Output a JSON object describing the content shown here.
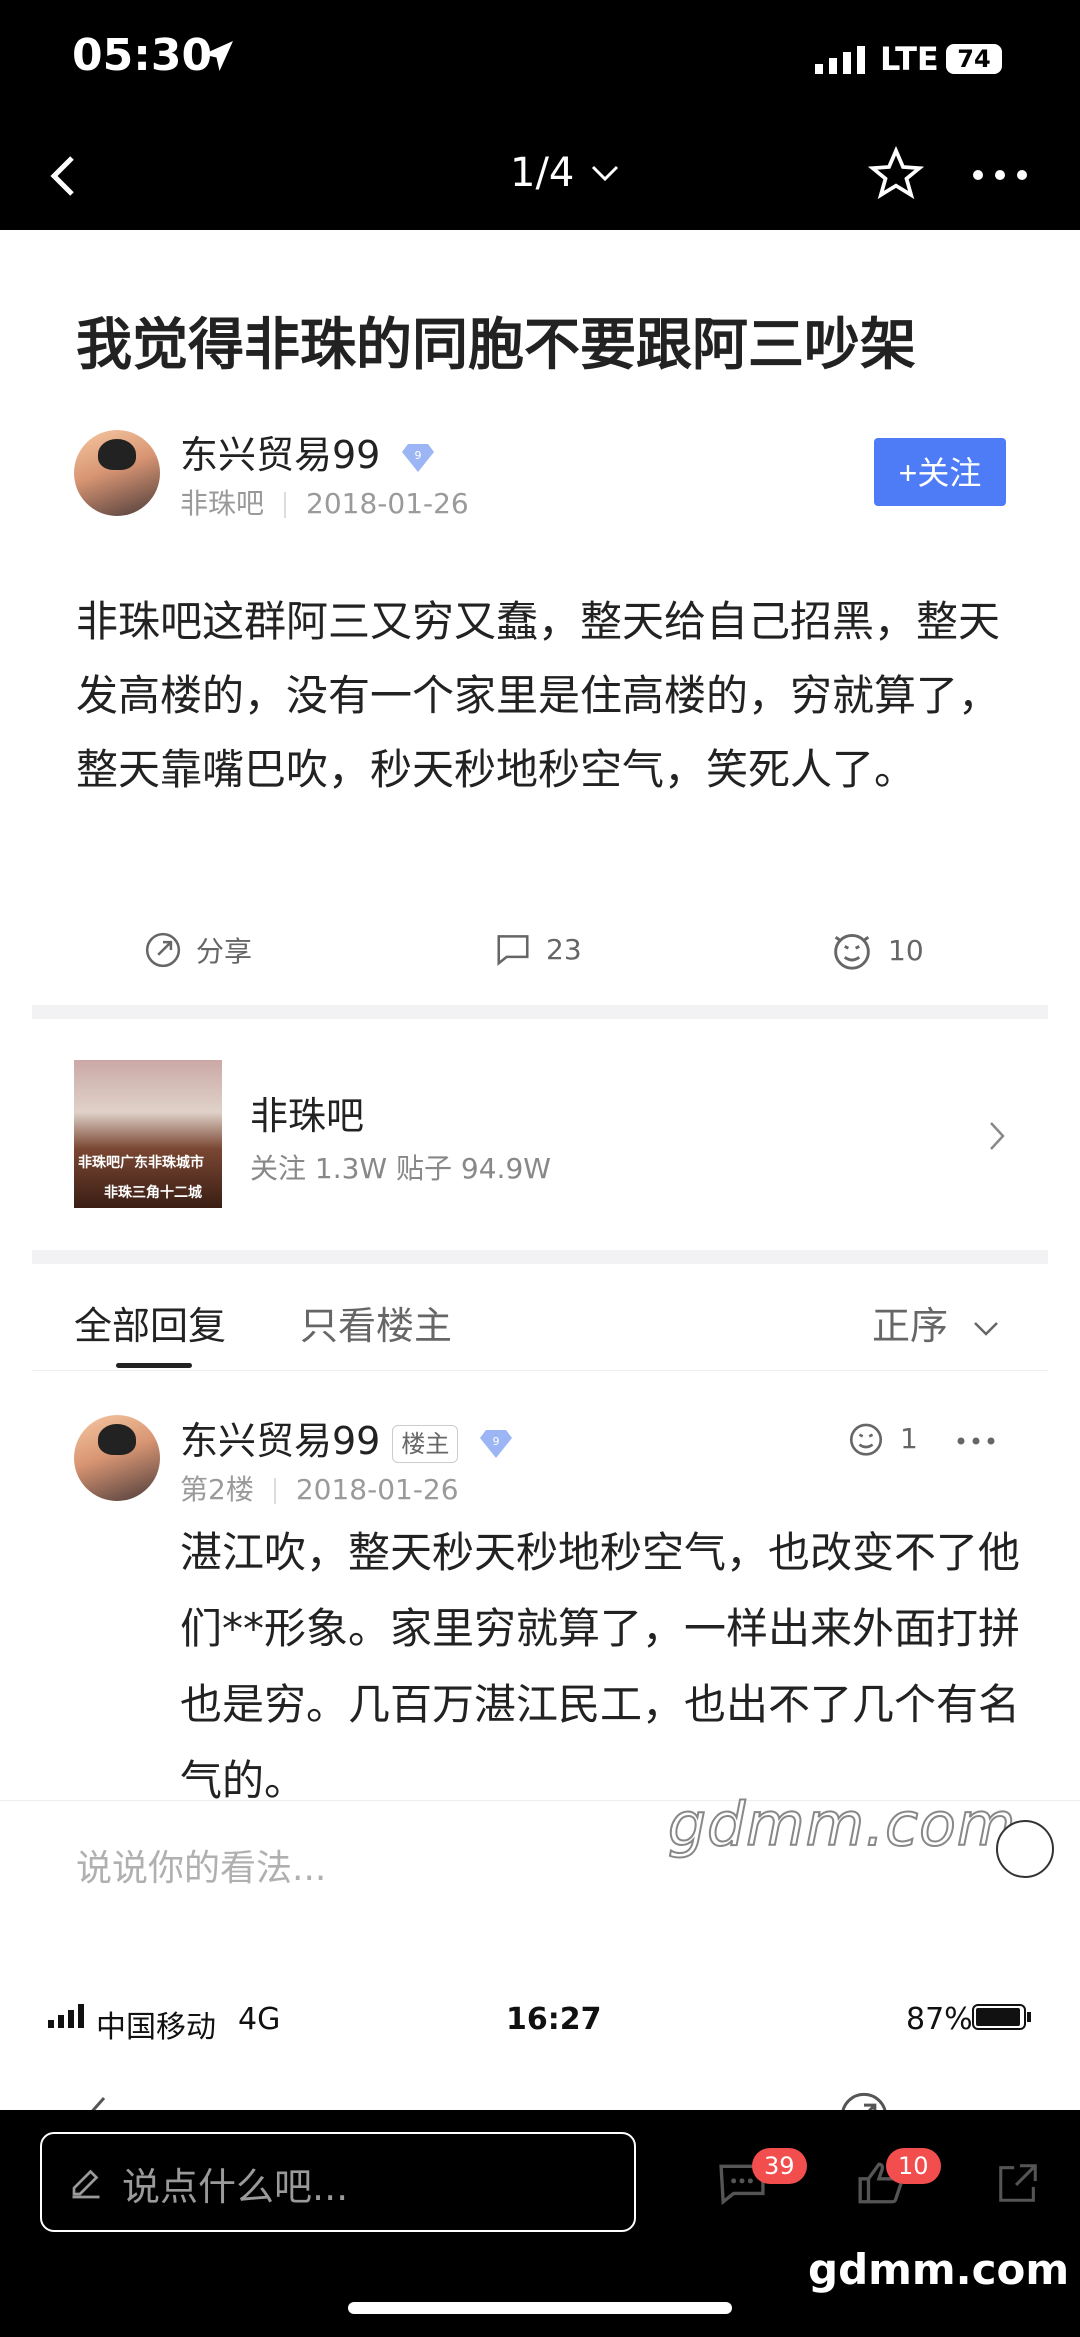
{
  "status_bar": {
    "time": "05:30",
    "network": "LTE",
    "battery": "74"
  },
  "top_nav": {
    "page_indicator": "1/4"
  },
  "post": {
    "title": "我觉得非珠的同胞不要跟阿三吵架",
    "author": "东兴贸易99",
    "author_badge": "9",
    "forum": "非珠吧",
    "date": "2018-01-26",
    "follow_label": "+关注",
    "body": "非珠吧这群阿三又穷又蠢，整天给自己招黑，整天发高楼的，没有一个家里是住高楼的，穷就算了，整天靠嘴巴吹，秒天秒地秒空气，笑死人了。",
    "actions": {
      "share": "分享",
      "comments": "23",
      "likes": "10"
    }
  },
  "forum_card": {
    "name": "非珠吧",
    "stats": "关注 1.3W   贴子 94.9W",
    "thumb_text_1": "非珠吧广东非珠城市",
    "thumb_text_2": "非珠三角十二城"
  },
  "tabs": {
    "all_replies": "全部回复",
    "owner_only": "只看楼主",
    "sort": "正序"
  },
  "reply": {
    "author": "东兴贸易99",
    "owner_tag": "楼主",
    "badge": "9",
    "floor": "第2楼",
    "date": "2018-01-26",
    "likes": "1",
    "text": "湛江吹，整天秒天秒地秒空气，也改变不了他们**形象。家里穷就算了，一样出来外面打拼也是穷。几百万湛江民工，也出不了几个有名气的。"
  },
  "comment_placeholder": "说说你的看法...",
  "watermark": "gdmm.com",
  "inner_status": {
    "carrier": "中国移动",
    "network": "4G",
    "time": "16:27",
    "battery": "87%"
  },
  "bottom_bar": {
    "placeholder": "说点什么吧...",
    "comment_count": "39",
    "like_count": "10"
  },
  "watermark_bottom": "gdmm.com"
}
